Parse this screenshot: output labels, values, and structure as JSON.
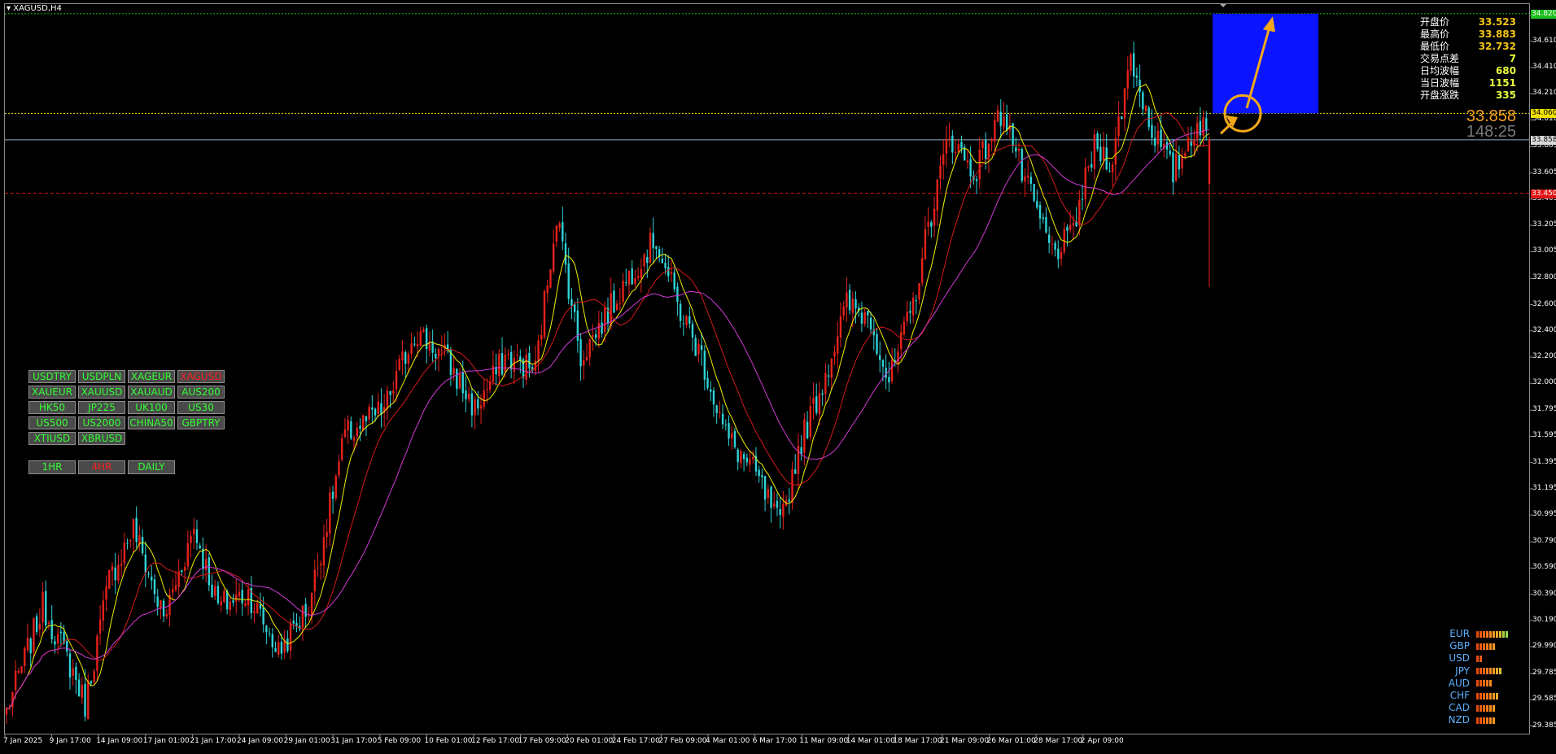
{
  "window": {
    "title": "XAGUSD,H4"
  },
  "colors": {
    "background": "#000000",
    "bull_candle": "#e6221b",
    "bear_candle": "#2fd3d8",
    "ma_fast": "#f0f000",
    "ma_mid": "#d41a1a",
    "ma_slow": "#d23ad6",
    "target_box": "#0a14ff",
    "arrow": "#f0a81a",
    "button_text": "#33ff33",
    "button_active_text": "#ff2020"
  },
  "info_panel": {
    "rows": [
      {
        "label": "开盘价",
        "value": "33.523"
      },
      {
        "label": "最高价",
        "value": "33.883"
      },
      {
        "label": "最低价",
        "value": "32.732"
      },
      {
        "label": "交易点差",
        "value": "7"
      },
      {
        "label": "日均波幅",
        "value": "680"
      },
      {
        "label": "当日波幅",
        "value": "1151"
      },
      {
        "label": "开盘涨跌",
        "value": "335"
      }
    ]
  },
  "current_price": "33.858",
  "bar_timer": "148:25",
  "price_axis": {
    "labels": [
      "34.810",
      "34.610",
      "34.410",
      "34.210",
      "34.010",
      "33.805",
      "33.605",
      "33.405",
      "33.205",
      "33.005",
      "32.800",
      "32.600",
      "32.400",
      "32.200",
      "32.000",
      "31.795",
      "31.595",
      "31.395",
      "31.195",
      "30.995",
      "30.790",
      "30.590",
      "30.390",
      "30.190",
      "29.990",
      "29.785",
      "29.585",
      "29.385"
    ],
    "tags": [
      {
        "value": "34.820",
        "bg": "#1bbf1b",
        "fg": "#ffffff"
      },
      {
        "value": "34.060",
        "bg": "#f0e000",
        "fg": "#000000"
      },
      {
        "value": "33.858",
        "bg": "#d9d9d9",
        "fg": "#000000"
      },
      {
        "value": "33.450",
        "bg": "#e01515",
        "fg": "#ffffff"
      }
    ]
  },
  "time_axis": {
    "labels": [
      "7 Jan 2025",
      "9 Jan 17:00",
      "14 Jan 09:00",
      "17 Jan 01:00",
      "21 Jan 17:00",
      "24 Jan 09:00",
      "29 Jan 01:00",
      "31 Jan 17:00",
      "5 Feb 09:00",
      "10 Feb 01:00",
      "12 Feb 17:00",
      "17 Feb 09:00",
      "20 Feb 01:00",
      "24 Feb 17:00",
      "27 Feb 09:00",
      "4 Mar 01:00",
      "6 Mar 17:00",
      "11 Mar 09:00",
      "14 Mar 01:00",
      "18 Mar 17:00",
      "21 Mar 09:00",
      "26 Mar 01:00",
      "28 Mar 17:00",
      "2 Apr 09:00"
    ]
  },
  "symbol_buttons": [
    {
      "label": "USDTRY",
      "active": false
    },
    {
      "label": "USDPLN",
      "active": false
    },
    {
      "label": "XAGEUR",
      "active": false
    },
    {
      "label": "XAGUSD",
      "active": true
    },
    {
      "label": "XAUEUR",
      "active": false
    },
    {
      "label": "XAUUSD",
      "active": false
    },
    {
      "label": "XAUAUD",
      "active": false
    },
    {
      "label": "AUS200",
      "active": false
    },
    {
      "label": "HK50",
      "active": false
    },
    {
      "label": "JP225",
      "active": false
    },
    {
      "label": "UK100",
      "active": false
    },
    {
      "label": "US30",
      "active": false
    },
    {
      "label": "US500",
      "active": false
    },
    {
      "label": "US2000",
      "active": false
    },
    {
      "label": "CHINA50",
      "active": false
    },
    {
      "label": "GBPTRY",
      "active": false
    },
    {
      "label": "XTIUSD",
      "active": false
    },
    {
      "label": "XBRUSD",
      "active": false
    }
  ],
  "timeframe_buttons": [
    {
      "label": "1HR",
      "active": false
    },
    {
      "label": "4HR",
      "active": true
    },
    {
      "label": "DAILY",
      "active": false
    }
  ],
  "currency_strength": [
    {
      "currency": "EUR",
      "strength": 10
    },
    {
      "currency": "GBP",
      "strength": 6
    },
    {
      "currency": "USD",
      "strength": 2
    },
    {
      "currency": "JPY",
      "strength": 8
    },
    {
      "currency": "AUD",
      "strength": 5
    },
    {
      "currency": "CHF",
      "strength": 7
    },
    {
      "currency": "CAD",
      "strength": 6
    },
    {
      "currency": "NZD",
      "strength": 6
    }
  ],
  "chart_data": {
    "type": "candlestick",
    "symbol": "XAGUSD",
    "timeframe": "H4",
    "ylim": [
      29.385,
      34.9
    ],
    "grid": false,
    "horizontal_levels": [
      {
        "price": 34.82,
        "color": "#1bbf1b",
        "style": "dotted"
      },
      {
        "price": 34.06,
        "color": "#f0e000",
        "style": "dotted"
      },
      {
        "price": 33.858,
        "color": "#8fb0c8",
        "style": "solid"
      },
      {
        "price": 33.45,
        "color": "#e01515",
        "style": "dashed"
      }
    ],
    "target_zone": {
      "price_top": 34.82,
      "price_bottom": 34.06
    },
    "anchors": [
      [
        0,
        29.5
      ],
      [
        12,
        30.3
      ],
      [
        22,
        29.8
      ],
      [
        26,
        29.55
      ],
      [
        34,
        30.5
      ],
      [
        42,
        30.9
      ],
      [
        52,
        30.2
      ],
      [
        62,
        30.9
      ],
      [
        70,
        30.3
      ],
      [
        80,
        30.4
      ],
      [
        90,
        29.95
      ],
      [
        100,
        30.3
      ],
      [
        112,
        31.6
      ],
      [
        125,
        31.8
      ],
      [
        135,
        32.4
      ],
      [
        145,
        32.2
      ],
      [
        155,
        31.8
      ],
      [
        165,
        32.2
      ],
      [
        175,
        32.1
      ],
      [
        182,
        33.3
      ],
      [
        190,
        32.2
      ],
      [
        198,
        32.5
      ],
      [
        208,
        32.9
      ],
      [
        215,
        33.1
      ],
      [
        222,
        32.6
      ],
      [
        230,
        32.2
      ],
      [
        238,
        31.6
      ],
      [
        248,
        31.3
      ],
      [
        256,
        30.9
      ],
      [
        262,
        31.5
      ],
      [
        270,
        32.0
      ],
      [
        278,
        32.6
      ],
      [
        286,
        32.5
      ],
      [
        292,
        32.0
      ],
      [
        300,
        32.6
      ],
      [
        305,
        33.2
      ],
      [
        312,
        33.9
      ],
      [
        320,
        33.6
      ],
      [
        330,
        34.1
      ],
      [
        336,
        33.6
      ],
      [
        346,
        33.0
      ],
      [
        352,
        33.1
      ],
      [
        360,
        33.8
      ],
      [
        366,
        33.7
      ],
      [
        372,
        34.5
      ],
      [
        378,
        34.0
      ],
      [
        386,
        33.6
      ],
      [
        394,
        34.0
      ],
      [
        398,
        33.86
      ]
    ]
  }
}
